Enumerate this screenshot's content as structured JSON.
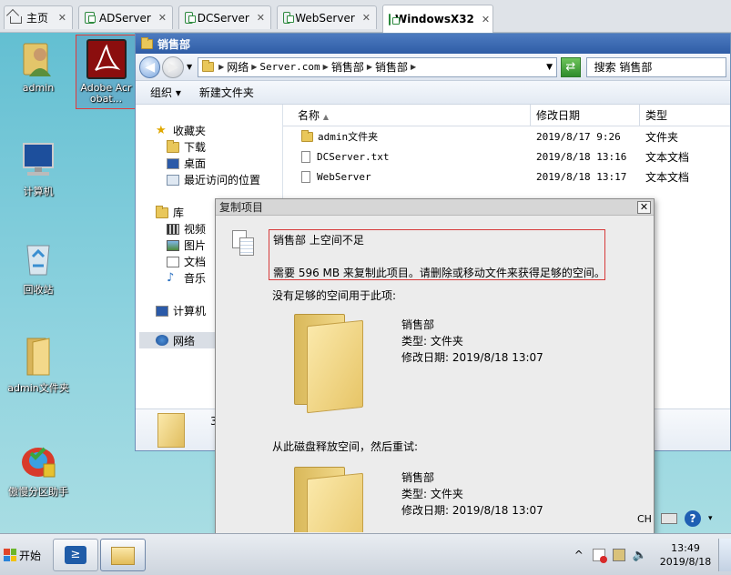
{
  "vm_tabs": [
    {
      "label": "主页",
      "icon": "home-icon",
      "active": false
    },
    {
      "label": "ADServer",
      "icon": "vm-icon",
      "active": false
    },
    {
      "label": "DCServer",
      "icon": "vm-icon",
      "active": false
    },
    {
      "label": "WebServer",
      "icon": "vm-icon",
      "active": false
    },
    {
      "label": "WindowsX32",
      "icon": "vm-icon",
      "active": true
    }
  ],
  "desktop_icons": [
    {
      "label": "admin",
      "icon": "user-icon"
    },
    {
      "label": "Adobe Acrobat...",
      "icon": "acrobat-icon",
      "selected": true
    },
    {
      "label": "计算机",
      "icon": "computer-icon"
    },
    {
      "label": "回收站",
      "icon": "recycle-bin-icon"
    },
    {
      "label": "admin文件夹",
      "icon": "folder-icon"
    },
    {
      "label": "傲慢分区助手",
      "icon": "partition-assistant-icon"
    }
  ],
  "explorer": {
    "title": "销售部",
    "address": [
      "网络",
      "Server.com",
      "销售部",
      "销售部"
    ],
    "search_placeholder": "搜索 销售部",
    "commands": {
      "organize": "组织 ▾",
      "new_folder": "新建文件夹"
    },
    "nav": {
      "favorites": "收藏夹",
      "downloads": "下载",
      "desktop": "桌面",
      "recent": "最近访问的位置",
      "libraries": "库",
      "videos": "视频",
      "pictures": "图片",
      "documents": "文档",
      "music": "音乐",
      "computer": "计算机",
      "network": "网络"
    },
    "columns": {
      "name": "名称",
      "modified": "修改日期",
      "type": "类型"
    },
    "files": [
      {
        "name": "admin文件夹",
        "modified": "2019/8/17 9:26",
        "type": "文件夹",
        "icon": "folder-icon"
      },
      {
        "name": "DCServer.txt",
        "modified": "2019/8/18 13:16",
        "type": "文本文档",
        "icon": "text-file-icon"
      },
      {
        "name": "WebServer",
        "modified": "2019/8/18 13:17",
        "type": "文本文档",
        "icon": "text-file-icon"
      }
    ],
    "details_count": "3"
  },
  "dialog": {
    "title": "复制项目",
    "close": "✕",
    "error_title": "销售部 上空间不足",
    "error_detail": "需要 596 MB 来复制此项目。请删除或移动文件来获得足够的空间。",
    "section1": "没有足够的空间用于此项:",
    "section2": "从此磁盘释放空间，然后重试:",
    "item1": {
      "name": "销售部",
      "type": "类型: 文件夹",
      "modified": "修改日期: 2019/8/18 13:07"
    },
    "item2": {
      "name": "销售部",
      "type": "类型: 文件夹",
      "modified": "修改日期: 2019/8/18 13:07"
    }
  },
  "taskbar": {
    "start": "开始",
    "lang": "CH",
    "time": "13:49",
    "date": "2019/8/18",
    "tray_up": "^"
  }
}
